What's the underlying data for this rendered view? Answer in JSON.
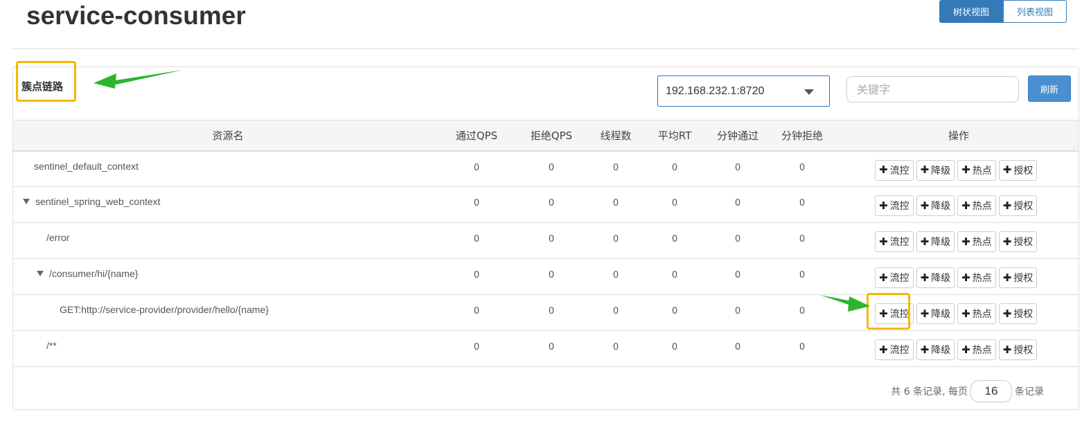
{
  "app": {
    "title": "service-consumer"
  },
  "view_toggle": {
    "tree_label": "树状视图",
    "list_label": "列表视图"
  },
  "panel": {
    "title": "簇点链路"
  },
  "machine_select": {
    "value": "192.168.232.1:8720"
  },
  "search": {
    "placeholder": "关键字",
    "refresh_label": "刷新"
  },
  "table": {
    "columns": [
      "资源名",
      "通过QPS",
      "拒绝QPS",
      "线程数",
      "平均RT",
      "分钟通过",
      "分钟拒绝",
      "操作"
    ],
    "ops": {
      "flow": "流控",
      "degrade": "降级",
      "hot": "热点",
      "auth": "授权"
    },
    "rows": [
      {
        "name": "sentinel_default_context",
        "pass_qps": "0",
        "block_qps": "0",
        "threads": "0",
        "avg_rt": "0",
        "min_pass": "0",
        "min_block": "0"
      },
      {
        "name": "sentinel_spring_web_context",
        "pass_qps": "0",
        "block_qps": "0",
        "threads": "0",
        "avg_rt": "0",
        "min_pass": "0",
        "min_block": "0"
      },
      {
        "name": "/error",
        "pass_qps": "0",
        "block_qps": "0",
        "threads": "0",
        "avg_rt": "0",
        "min_pass": "0",
        "min_block": "0"
      },
      {
        "name": "/consumer/hi/{name}",
        "pass_qps": "0",
        "block_qps": "0",
        "threads": "0",
        "avg_rt": "0",
        "min_pass": "0",
        "min_block": "0"
      },
      {
        "name": "GET:http://service-provider/provider/hello/{name}",
        "pass_qps": "0",
        "block_qps": "0",
        "threads": "0",
        "avg_rt": "0",
        "min_pass": "0",
        "min_block": "0"
      },
      {
        "name": "/**",
        "pass_qps": "0",
        "block_qps": "0",
        "threads": "0",
        "avg_rt": "0",
        "min_pass": "0",
        "min_block": "0"
      }
    ]
  },
  "pagination": {
    "prefix": "共 6 条记录, 每页",
    "page_size": "16",
    "suffix": "条记录"
  },
  "colors": {
    "primary": "#337ab7",
    "highlight": "#f5b800",
    "arrow": "#2db52d"
  }
}
